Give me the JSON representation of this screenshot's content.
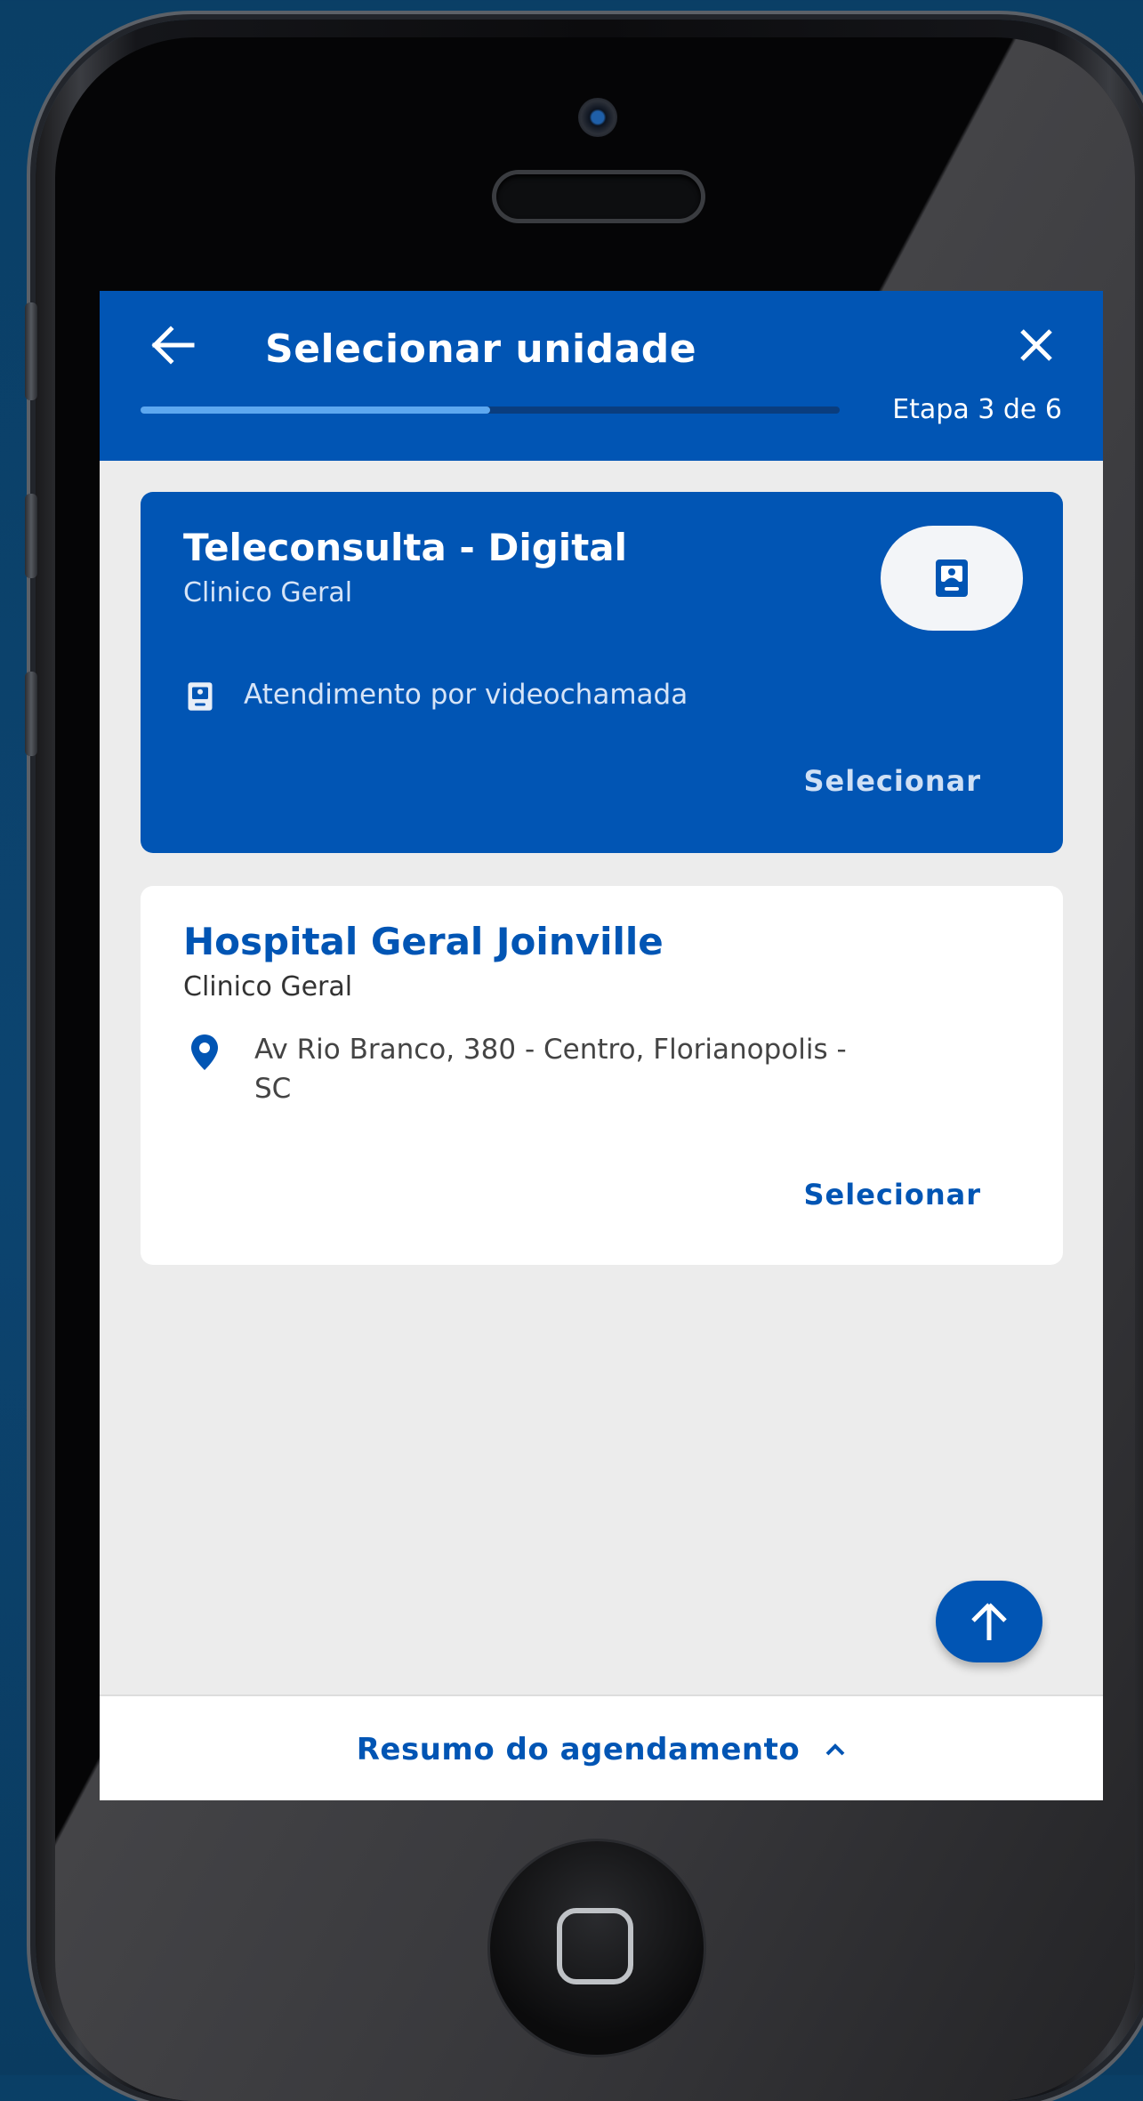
{
  "theme": {
    "primary": "#0155b4",
    "primary_dark": "#0a3d7e",
    "progress_light": "#5da8f0",
    "background": "#ececec"
  },
  "header": {
    "title": "Selecionar unidade",
    "step_label": "Etapa 3 de 6",
    "progress_fraction": 0.5,
    "back_icon": "arrow-left-icon",
    "close_icon": "close-icon"
  },
  "units": [
    {
      "name": "Teleconsulta - Digital",
      "specialty": "Clinico Geral",
      "detail": "Atendimento por videochamada",
      "detail_icon": "video-call-icon",
      "action": "Selecionar",
      "highlighted": true
    },
    {
      "name": "Hospital Geral Joinville",
      "specialty": "Clinico Geral",
      "address_line1": "Av Rio Branco, 380 - Centro, Florianopolis -",
      "address_line2": "SC",
      "detail_icon": "location-pin-icon",
      "action": "Selecionar",
      "highlighted": false
    }
  ],
  "fab": {
    "icon": "arrow-up-icon"
  },
  "footer": {
    "summary_label": "Resumo do agendamento",
    "chevron_icon": "chevron-up-icon"
  }
}
